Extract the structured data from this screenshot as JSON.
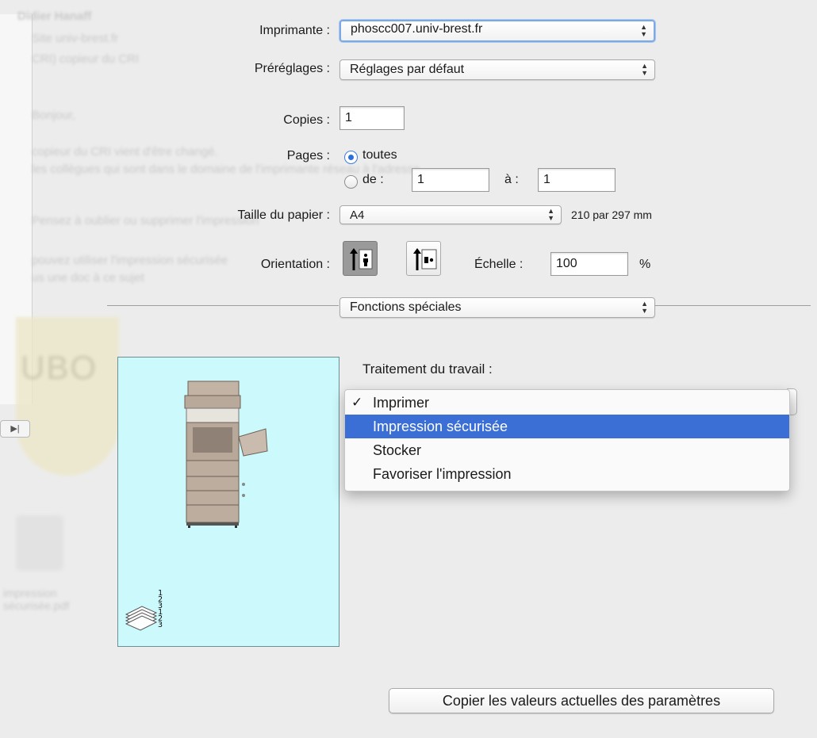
{
  "background": {
    "blurred_lines": [
      "Didier Hanaff",
      "Site univ-brest.fr",
      "CRI) copieur du CRI",
      "Bonjour,",
      "copieur du CRI vient d'être changé.",
      "les collègues qui sont dans le domaine de l'imprimante réseau à l'adresse",
      "Pensez à oublier ou supprimer l'impression",
      "pouvez utiliser l'impression sécurisée",
      "us une doc à ce sujet"
    ],
    "attachment_label": "impression sécurisée.pdf",
    "logo_text": "UBO"
  },
  "form": {
    "printer_label": "Imprimante :",
    "printer_value": "phoscc007.univ-brest.fr",
    "presets_label": "Préréglages :",
    "presets_value": "Réglages par défaut",
    "copies_label": "Copies :",
    "copies_value": "1",
    "pages_label": "Pages :",
    "pages_all_label": "toutes",
    "pages_from_label": "de :",
    "pages_from_value": "1",
    "pages_to_label": "à :",
    "pages_to_value": "1",
    "paper_label": "Taille du papier :",
    "paper_value": "A4",
    "paper_size_text": "210 par 297 mm",
    "orientation_label": "Orientation :",
    "scale_label": "Échelle :",
    "scale_value": "100",
    "scale_unit": "%",
    "section_value": "Fonctions spéciales",
    "job_label": "Traitement du travail :"
  },
  "menu": {
    "items": [
      {
        "label": "Imprimer",
        "checked": true
      },
      {
        "label": "Impression sécurisée",
        "selected": true
      },
      {
        "label": "Stocker"
      },
      {
        "label": "Favoriser l'impression"
      }
    ],
    "checkmark": "✓"
  },
  "preview": {
    "stack_numbers": "1 2 3 1 2 3"
  },
  "buttons": {
    "copy_params": "Copier les valeurs actuelles des paramètres"
  }
}
